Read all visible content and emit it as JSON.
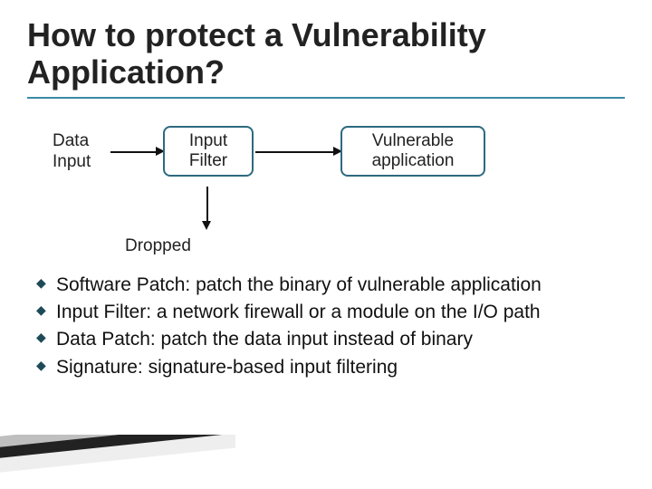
{
  "title": "How to protect a Vulnerability Application?",
  "diagram": {
    "data_label": "Data\nInput",
    "filter_label": "Input\nFilter",
    "vuln_label": "Vulnerable\napplication",
    "dropped_label": "Dropped"
  },
  "bullets": [
    "Software Patch: patch the binary of vulnerable application",
    "Input Filter: a network firewall or a module on the I/O path",
    "Data Patch: patch the data input instead of binary",
    "Signature: signature-based input filtering"
  ]
}
